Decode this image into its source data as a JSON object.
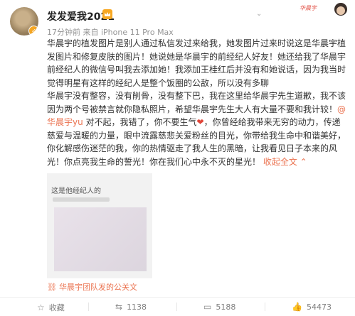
{
  "user": {
    "name": "发发爱我2021"
  },
  "meta": {
    "time": "17分钟前",
    "source": "来自 iPhone 11 Pro Max"
  },
  "post": {
    "p1": "华晨宇的植发图片是别人通过私信发过来给我，她发图片过来时说这是华晨宇植发图片和修复皮肤的图片！她说她是华晨宇的前经纪人好友！她还给我了华晨宇前经纪人的微信号叫我去添加她！我添加王桂红后并没有和她说话，因为我当时觉得明星有这样的经纪人是整个饭圈的公敌，所以没有多聊",
    "p2a": "华晨宇没有整容，没有削骨，没有整下巴，我在这里给华晨宇先生道歉，我不该因为两个号被禁言就你隐私照片，希望华晨宇先生大人有大量不要和我计较！",
    "mention": "@华晨宇yu",
    "p2b": " 对不起，我错了，你不要生气",
    "p2c": "，你曾经给我带来无穷的动力，传递慈爱与温暖的力量，眼中流露慈悲关爱粉丝的目光，你带给我生命中和谐美好，你化解感伤迷茫的我，你的热情驱走了我人生的黑暗，让我看见日子本来的风光！你点亮我生命的誓光！你在我们心中永不灭的星光！",
    "collapse": "收起全文",
    "image_caption": "这是他经纪人的"
  },
  "source_link": "华晨宇团队发的公关文",
  "actions": {
    "favorite": "收藏",
    "repost": "1138",
    "comment": "5188",
    "like": "54473"
  }
}
